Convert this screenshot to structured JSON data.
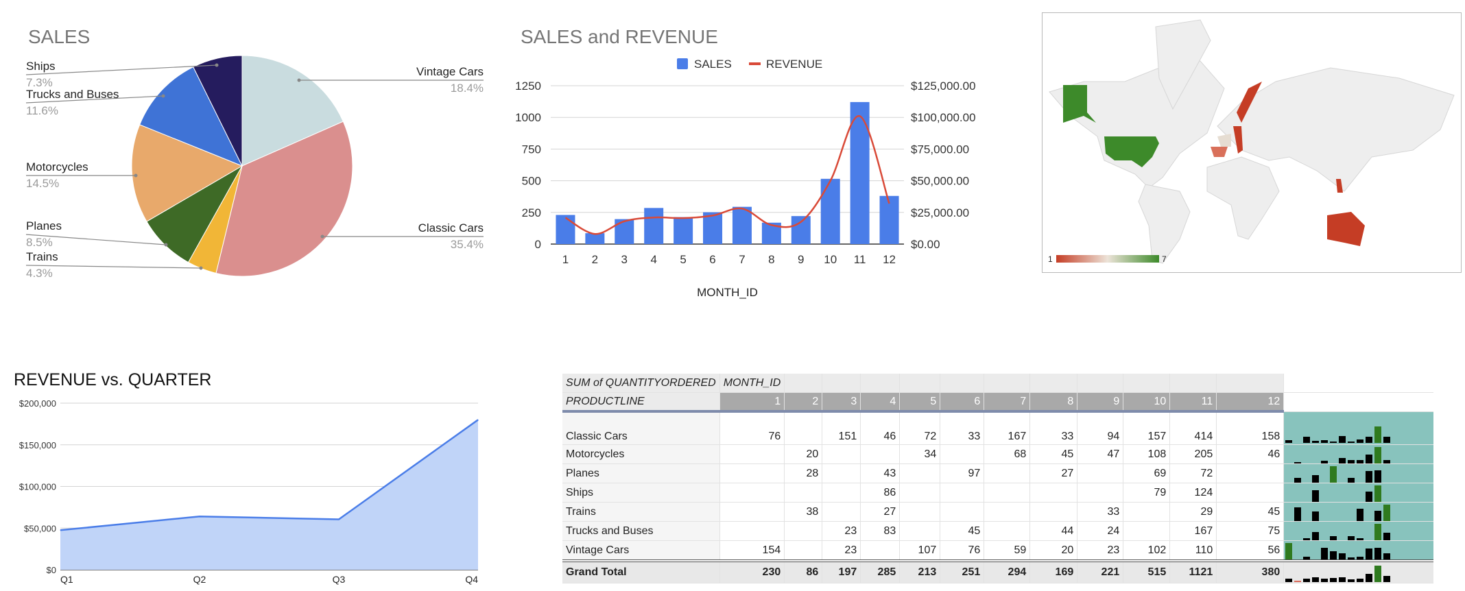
{
  "pie": {
    "title": "SALES",
    "slices": [
      {
        "label": "Vintage Cars",
        "pct_text": "18.4%",
        "value": 18.4,
        "color": "#c9dcdf"
      },
      {
        "label": "Classic Cars",
        "pct_text": "35.4%",
        "value": 35.4,
        "color": "#da8f8e"
      },
      {
        "label": "Trains",
        "pct_text": "4.3%",
        "value": 4.3,
        "color": "#f1b637"
      },
      {
        "label": "Planes",
        "pct_text": "8.5%",
        "value": 8.5,
        "color": "#3e6a26"
      },
      {
        "label": "Motorcycles",
        "pct_text": "14.5%",
        "value": 14.5,
        "color": "#e8a96b"
      },
      {
        "label": "Trucks and Buses",
        "pct_text": "11.6%",
        "value": 11.6,
        "color": "#3f73d6"
      },
      {
        "label": "Ships",
        "pct_text": "7.3%",
        "value": 7.3,
        "color": "#251c5e"
      }
    ]
  },
  "combo": {
    "title": "SALES and REVENUE",
    "legend": {
      "sales": "SALES",
      "revenue": "REVENUE"
    },
    "xlabel": "MONTH_ID",
    "categories": [
      "1",
      "2",
      "3",
      "4",
      "5",
      "6",
      "7",
      "8",
      "9",
      "10",
      "11",
      "12"
    ],
    "left_ticks": [
      "0",
      "250",
      "500",
      "750",
      "1000",
      "1250"
    ],
    "right_ticks": [
      "$0.00",
      "$25,000.00",
      "$50,000.00",
      "$75,000.00",
      "$100,000.00",
      "$125,000.00"
    ],
    "sales_color": "#4a7de8",
    "revenue_color": "#d94a38"
  },
  "chart_data": [
    {
      "type": "pie",
      "title": "SALES",
      "categories": [
        "Vintage Cars",
        "Classic Cars",
        "Trains",
        "Planes",
        "Motorcycles",
        "Trucks and Buses",
        "Ships"
      ],
      "values": [
        18.4,
        35.4,
        4.3,
        8.5,
        14.5,
        11.6,
        7.3
      ]
    },
    {
      "type": "bar",
      "title": "SALES and REVENUE",
      "xlabel": "MONTH_ID",
      "categories": [
        1,
        2,
        3,
        4,
        5,
        6,
        7,
        8,
        9,
        10,
        11,
        12
      ],
      "series": [
        {
          "name": "SALES",
          "type": "bar",
          "axis": "left",
          "values": [
            230,
            86,
            197,
            285,
            213,
            251,
            294,
            169,
            221,
            515,
            1121,
            380
          ]
        },
        {
          "name": "REVENUE",
          "type": "line",
          "axis": "right",
          "values": [
            20800,
            8000,
            18000,
            21000,
            20500,
            22500,
            28000,
            15000,
            17500,
            50000,
            101000,
            32000
          ]
        }
      ],
      "ylim_left": [
        0,
        1250
      ],
      "ylim_right": [
        0,
        125000
      ],
      "legend": "top",
      "grid": true
    },
    {
      "type": "area",
      "title": "REVENUE vs. QUARTER",
      "categories": [
        "Q1",
        "Q2",
        "Q3",
        "Q4"
      ],
      "values": [
        47500,
        64000,
        60500,
        180000
      ],
      "yticks": [
        "$0",
        "$50,000",
        "$100,000",
        "$150,000",
        "$200,000"
      ],
      "ylim": [
        0,
        200000
      ],
      "grid": true,
      "color": "#4a7de8"
    }
  ],
  "area": {
    "title": "REVENUE vs. QUARTER",
    "categories": [
      "Q1",
      "Q2",
      "Q3",
      "Q4"
    ],
    "yticks": [
      "$0",
      "$50,000",
      "$100,000",
      "$150,000",
      "$200,000"
    ]
  },
  "map": {
    "legend_min": "1",
    "legend_max": "7",
    "low_color": "#c53d25",
    "high_color": "#3d8a2a"
  },
  "pivot": {
    "corner": "SUM of QUANTITYORDERED",
    "col_field": "MONTH_ID",
    "row_field": "PRODUCTLINE",
    "months": [
      "1",
      "2",
      "3",
      "4",
      "5",
      "6",
      "7",
      "8",
      "9",
      "10",
      "11",
      "12"
    ],
    "rows": [
      {
        "label": "Classic Cars",
        "values": [
          "76",
          "",
          "151",
          "46",
          "72",
          "33",
          "167",
          "33",
          "94",
          "157",
          "414",
          "158"
        ]
      },
      {
        "label": "Motorcycles",
        "values": [
          "",
          "20",
          "",
          "",
          "34",
          "",
          "68",
          "45",
          "47",
          "108",
          "205",
          "46"
        ]
      },
      {
        "label": "Planes",
        "values": [
          "",
          "28",
          "",
          "43",
          "",
          "97",
          "",
          "27",
          "",
          "69",
          "72",
          ""
        ]
      },
      {
        "label": "Ships",
        "values": [
          "",
          "",
          "",
          "86",
          "",
          "",
          "",
          "",
          "",
          "79",
          "124",
          ""
        ]
      },
      {
        "label": "Trains",
        "values": [
          "",
          "38",
          "",
          "27",
          "",
          "",
          "",
          "",
          "33",
          "",
          "29",
          "45"
        ]
      },
      {
        "label": "Trucks and Buses",
        "values": [
          "",
          "",
          "23",
          "83",
          "",
          "45",
          "",
          "44",
          "24",
          "",
          "167",
          "75"
        ]
      },
      {
        "label": "Vintage Cars",
        "values": [
          "154",
          "",
          "23",
          "",
          "107",
          "76",
          "59",
          "20",
          "23",
          "102",
          "110",
          "56"
        ]
      }
    ],
    "total": {
      "label": "Grand Total",
      "values": [
        "230",
        "86",
        "197",
        "285",
        "213",
        "251",
        "294",
        "169",
        "221",
        "515",
        "1121",
        "380"
      ]
    }
  }
}
